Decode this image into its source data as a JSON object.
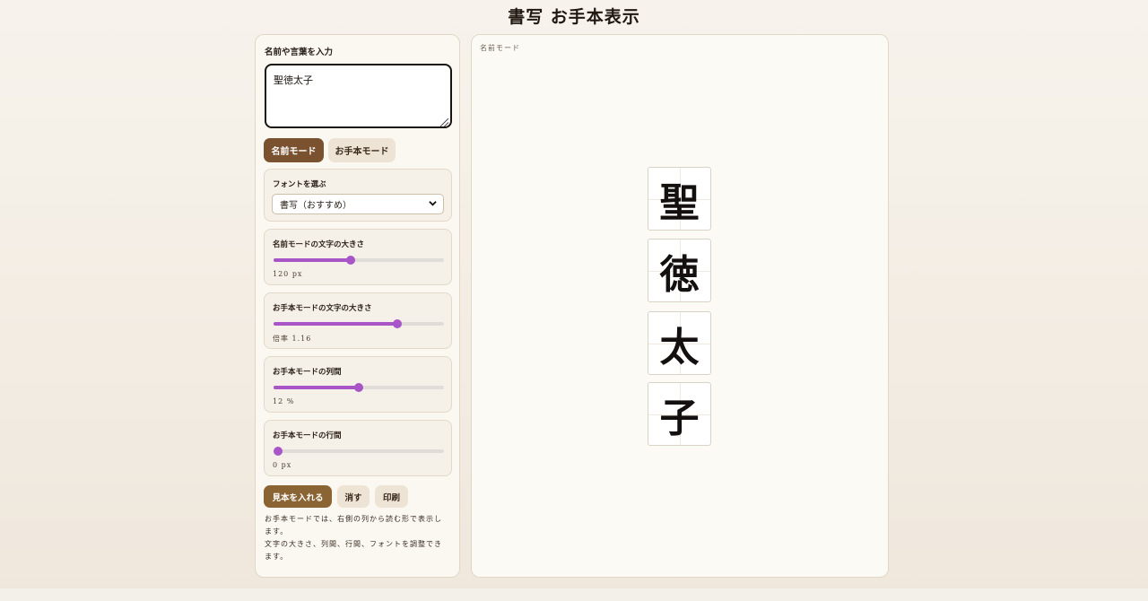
{
  "app": {
    "title": "書写 お手本表示"
  },
  "input": {
    "label": "名前や言葉を入力",
    "value": "聖徳太子"
  },
  "modes": {
    "name_mode": "名前モード",
    "sample_mode": "お手本モード",
    "active": "name_mode"
  },
  "font": {
    "label": "フォントを選ぶ",
    "selected": "書写（おすすめ）"
  },
  "sliders": [
    {
      "label": "名前モードの文字の大きさ",
      "value_text": "120 px",
      "fraction": 0.45
    },
    {
      "label": "お手本モードの文字の大きさ",
      "value_text": "倍率 1.16",
      "fraction": 0.725
    },
    {
      "label": "お手本モードの列間",
      "value_text": "12 %",
      "fraction": 0.5
    },
    {
      "label": "お手本モードの行間",
      "value_text": "0 px",
      "fraction": 0.0
    }
  ],
  "actions": {
    "insert_sample": "見本を入れる",
    "clear": "消す",
    "print": "印刷"
  },
  "note": {
    "line1": "お手本モードでは、右側の列から読む形で表示します。",
    "line2": "文字の大きさ、列間、行間、フォントを調整できます。"
  },
  "preview": {
    "mode_caption": "名前モード",
    "chars": [
      "聖",
      "徳",
      "太",
      "子"
    ]
  },
  "colors": {
    "accent": "#7a5230",
    "slider": "#a855c7",
    "background": "#f5efe6"
  }
}
